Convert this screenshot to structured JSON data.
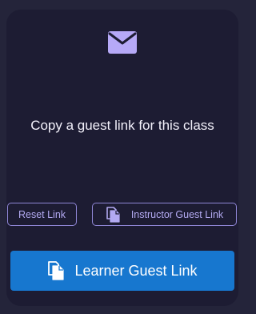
{
  "card": {
    "icon": "mail-icon",
    "message": "Copy a guest link for this class"
  },
  "actions": {
    "reset_label": "Reset Link",
    "instructor_label": "Instructor Guest Link",
    "instructor_icon": "copy-icon",
    "learner_label": "Learner Guest Link",
    "learner_icon": "copy-icon"
  },
  "colors": {
    "page_background": "#24243a",
    "card_background": "#1d1c33",
    "accent_purple": "#b3aaf2",
    "primary_blue": "#1777cf",
    "text_light": "#f3f1fb"
  }
}
